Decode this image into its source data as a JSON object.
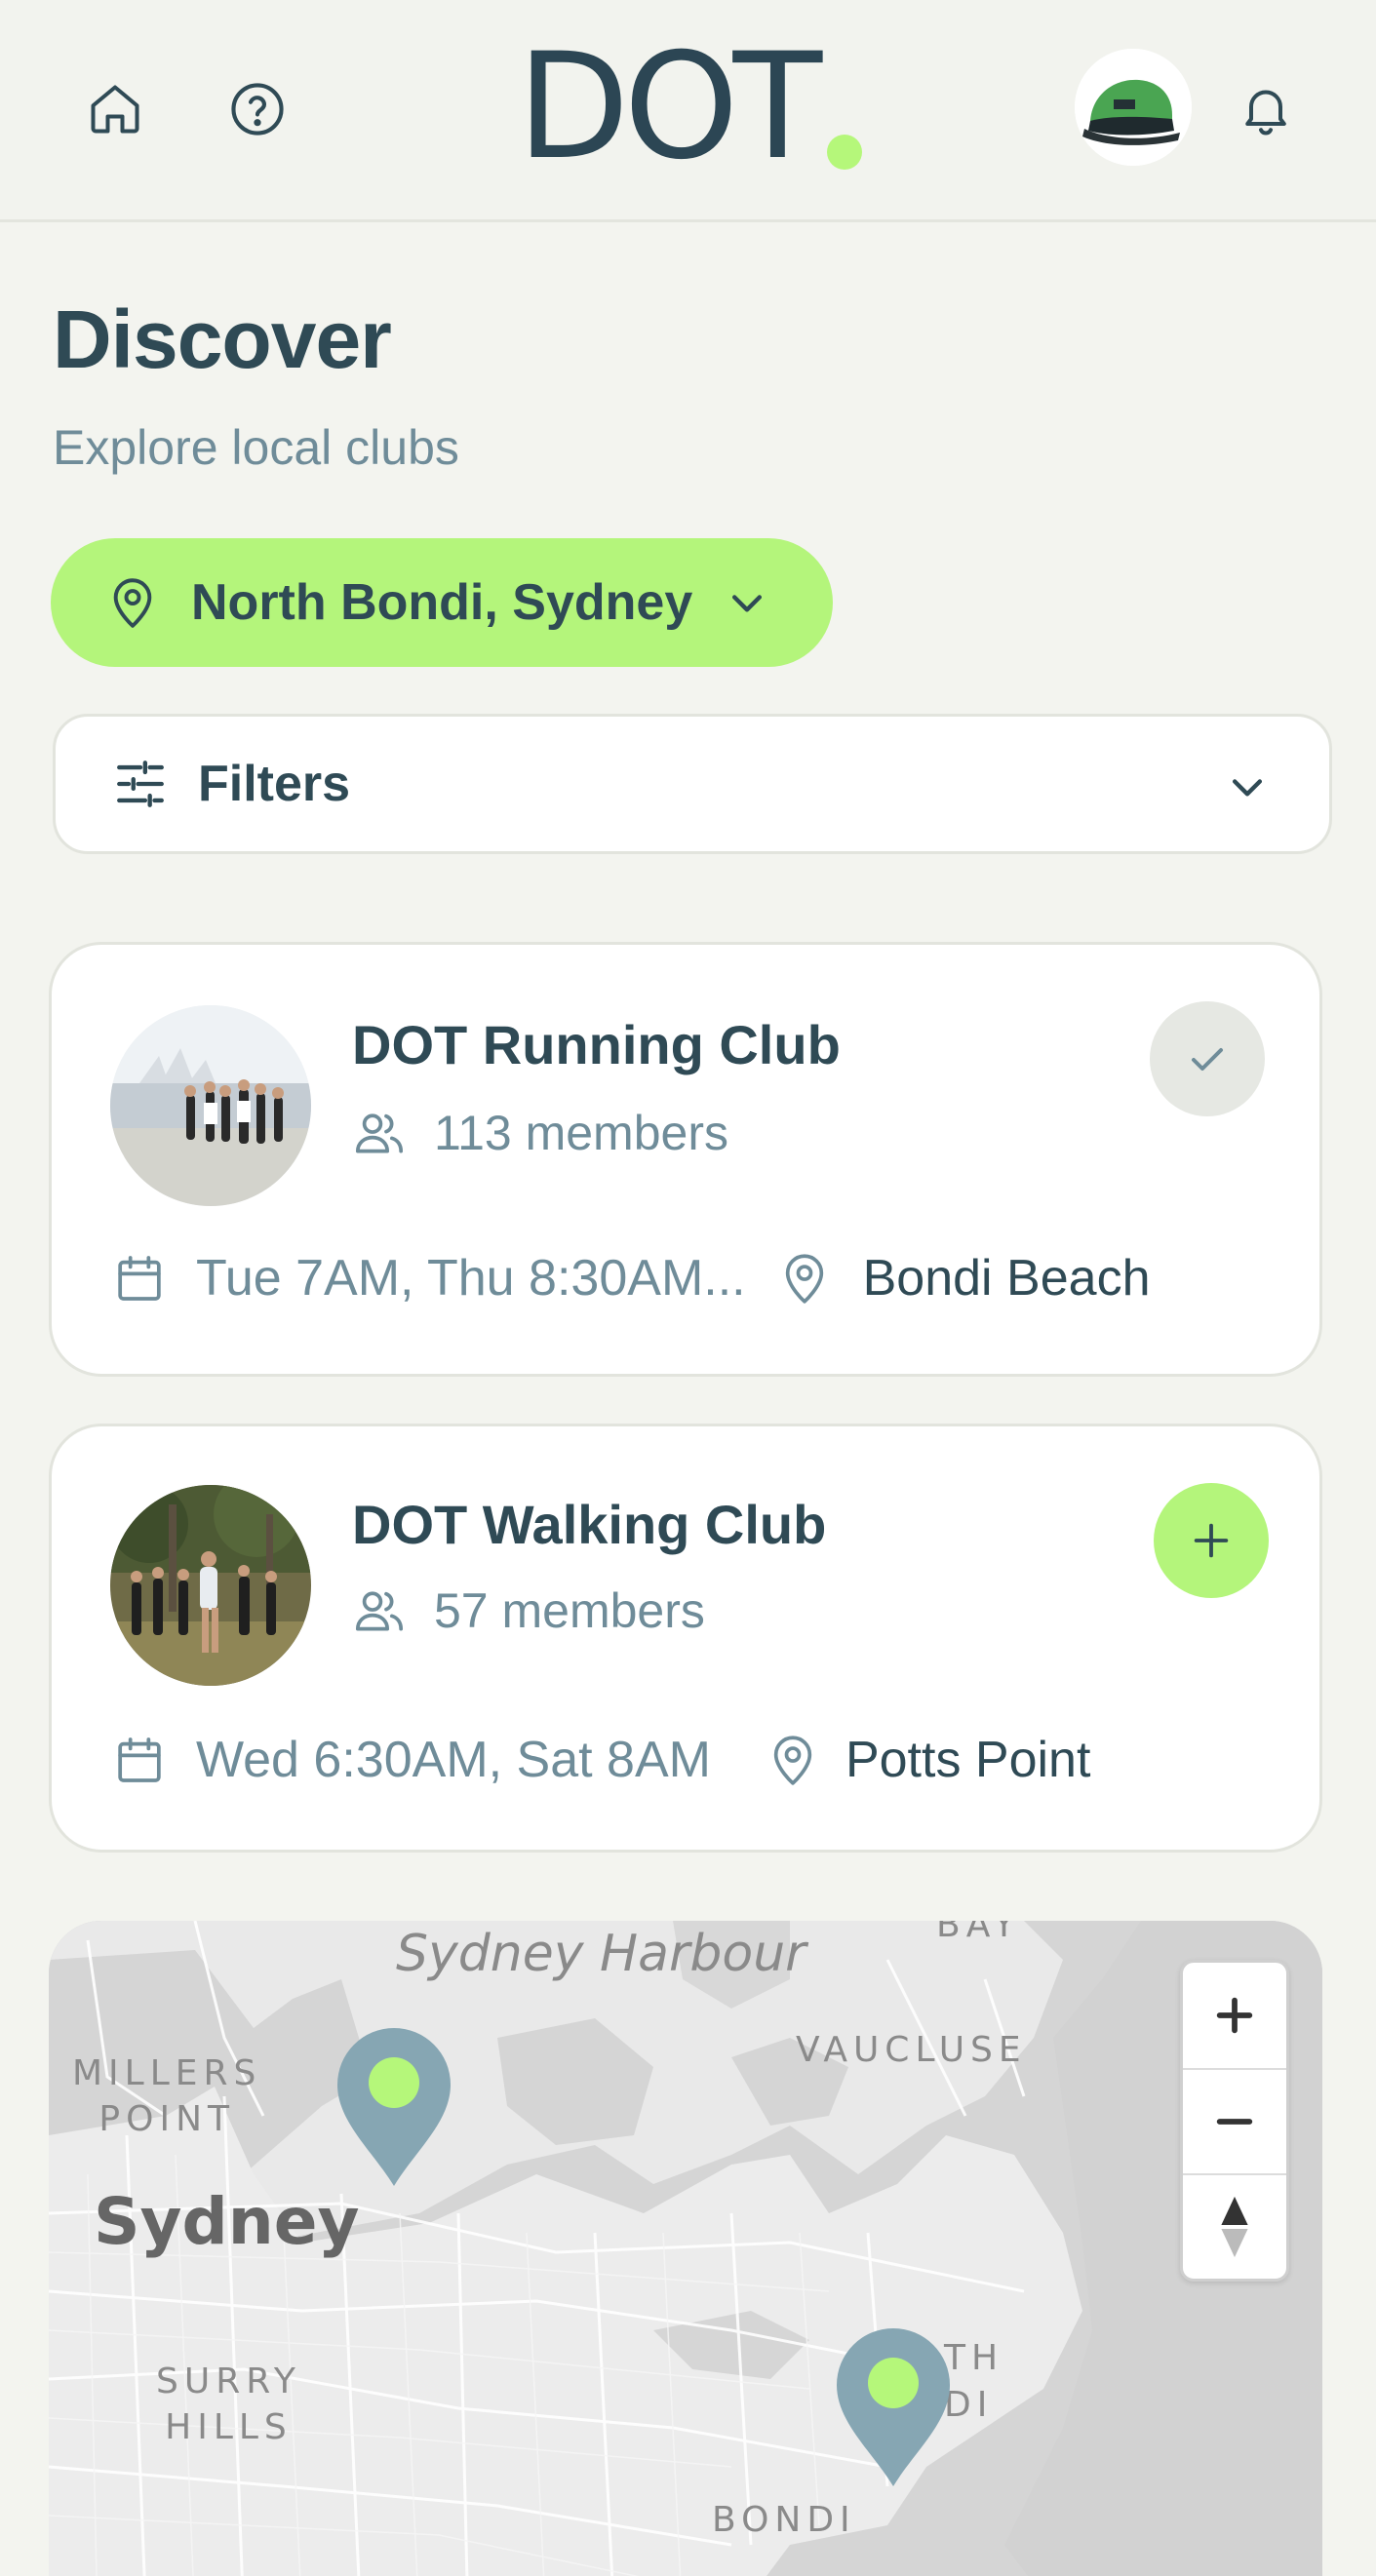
{
  "header": {
    "logo_text": "DOT",
    "home_icon": "home-icon",
    "help_icon": "help-circle-icon",
    "avatar": "user-avatar-cap",
    "bell_icon": "bell-icon",
    "accent": "#b5f77a",
    "brand_color": "#2c4654"
  },
  "page": {
    "title": "Discover",
    "subtitle": "Explore local clubs"
  },
  "location": {
    "label": "North Bondi, Sydney",
    "icon": "map-pin-icon"
  },
  "filters": {
    "label": "Filters",
    "icon": "sliders-icon"
  },
  "clubs": [
    {
      "name": "DOT Running Club",
      "members": "113 members",
      "schedule": "Tue 7AM, Thu 8:30AM...",
      "location": "Bondi Beach",
      "status": "joined",
      "action_icon": "check-icon"
    },
    {
      "name": "DOT Walking Club",
      "members": "57 members",
      "schedule": "Wed 6:30AM, Sat 8AM",
      "location": "Potts Point",
      "status": "not_joined",
      "action_icon": "plus-icon"
    }
  ],
  "map": {
    "labels": {
      "harbour": "Sydney Harbour",
      "bay": "BAY",
      "millers_1": "MILLERS",
      "millers_2": "POINT",
      "vaucluse": "VAUCLUSE",
      "city": "Sydney",
      "surry_1": "SURRY",
      "surry_2": "HILLS",
      "nth": "TH",
      "di": "DI",
      "bondi": "BONDI"
    },
    "zoom_in": "+",
    "zoom_out": "−",
    "compass_icon": "compass-icon",
    "marker_color": "#86a6b3"
  }
}
